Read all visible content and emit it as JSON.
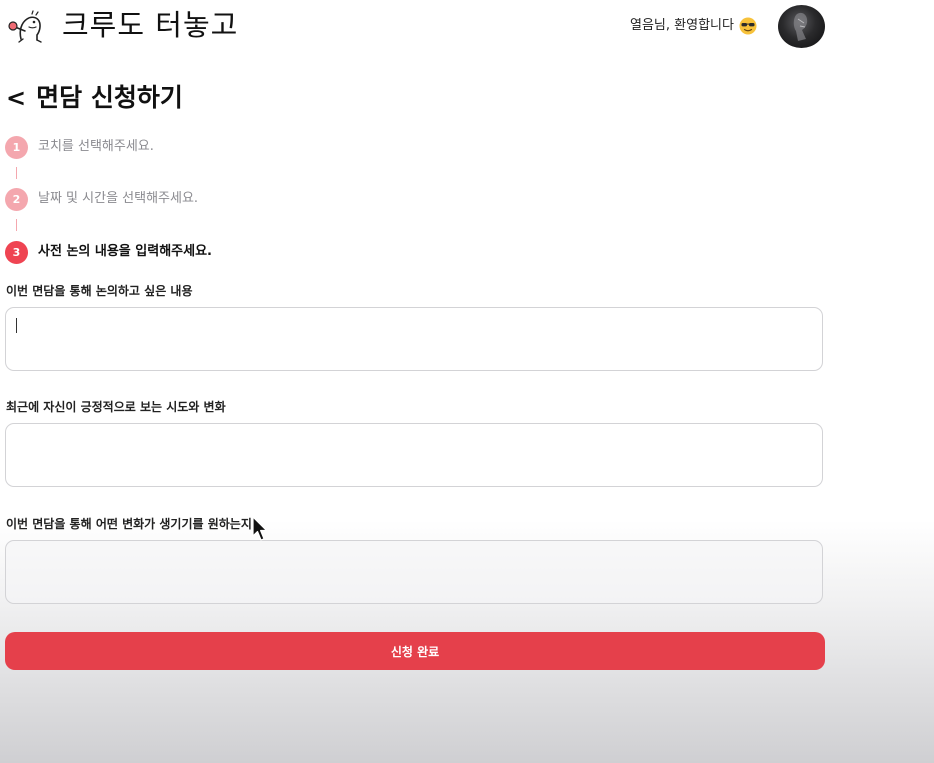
{
  "header": {
    "logo_icon": "dinosaur-mascot-icon",
    "logo_text": "크루도 터놓고",
    "welcome_text": "열음님, 환영합니다",
    "welcome_emoji": "sunglasses-face-icon",
    "avatar_icon": "user-avatar"
  },
  "page": {
    "back_symbol": "<",
    "title": "면담 신청하기"
  },
  "steps": [
    {
      "number": "1",
      "label": "코치를 선택해주세요.",
      "state": "done"
    },
    {
      "number": "2",
      "label": "날짜 및 시간을 선택해주세요.",
      "state": "done"
    },
    {
      "number": "3",
      "label": "사전 논의 내용을 입력해주세요.",
      "state": "active"
    }
  ],
  "form": {
    "fields": [
      {
        "label": "이번 면담을 통해 논의하고 싶은 내용",
        "value": ""
      },
      {
        "label": "최근에 자신이 긍정적으로 보는 시도와 변화",
        "value": ""
      },
      {
        "label": "이번 면담을 통해 어떤 변화가 생기기를 원하는지",
        "value": ""
      }
    ],
    "submit_label": "신청 완료"
  },
  "colors": {
    "accent": "#e5404b",
    "step_active": "#ef4452",
    "step_done": "#f4a7ae"
  }
}
